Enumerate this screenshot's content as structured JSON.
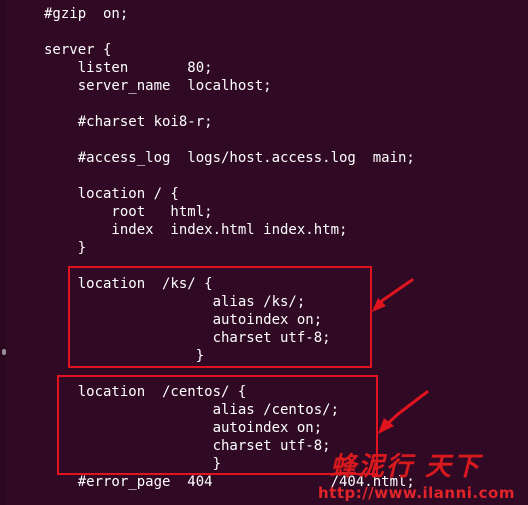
{
  "config": {
    "lines": [
      "#gzip  on;",
      "",
      "server {",
      "    listen       80;",
      "    server_name  localhost;",
      "",
      "    #charset koi8-r;",
      "",
      "    #access_log  logs/host.access.log  main;",
      "",
      "    location / {",
      "        root   html;",
      "        index  index.html index.htm;",
      "    }",
      "",
      "    location  /ks/ {",
      "                    alias /ks/;",
      "                    autoindex on;",
      "                    charset utf-8;",
      "                  }",
      "",
      "    location  /centos/ {",
      "                    alias /centos/;",
      "                    autoindex on;",
      "                    charset utf-8;",
      "                    }",
      "    #error_page  404              /404.html;"
    ]
  },
  "watermark": {
    "cn_text": "蜂泥行 天下",
    "url": "http://www.ilanni.com"
  },
  "colors": {
    "background": "#300a24",
    "text": "#ffffff",
    "annotation": "#e0141e"
  }
}
